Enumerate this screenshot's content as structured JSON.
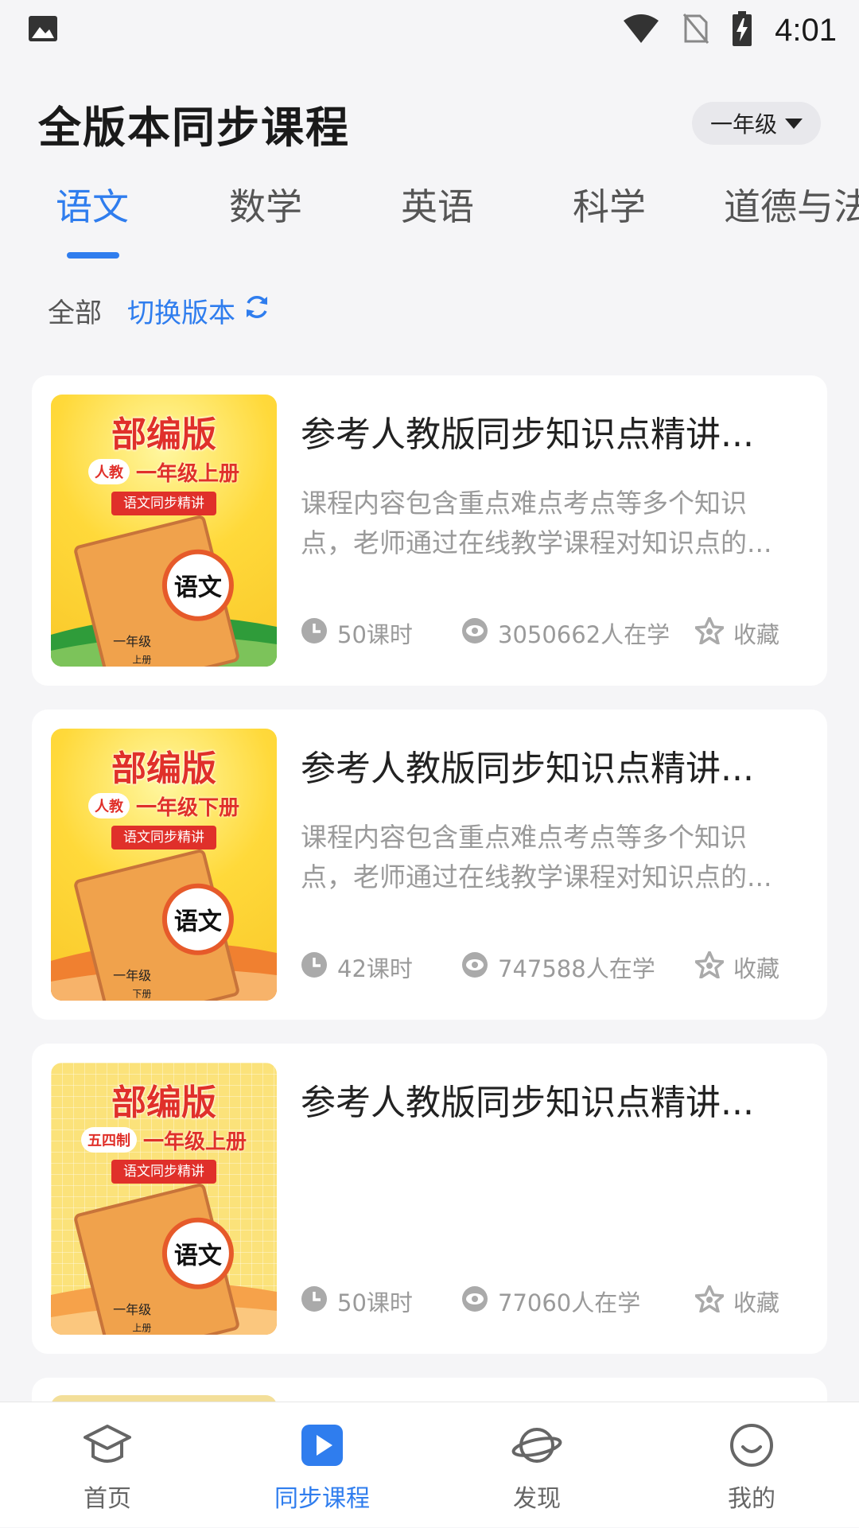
{
  "status_bar": {
    "time": "4:01"
  },
  "header": {
    "title": "全版本同步课程",
    "grade": "一年级"
  },
  "subject_tabs": [
    {
      "label": "语文",
      "active": true
    },
    {
      "label": "数学",
      "active": false
    },
    {
      "label": "英语",
      "active": false
    },
    {
      "label": "科学",
      "active": false
    },
    {
      "label": "道德与法",
      "active": false
    }
  ],
  "filter": {
    "all_label": "全部",
    "switch_label": "切换版本"
  },
  "courses": [
    {
      "title": "参考人教版同步知识点精讲...",
      "desc_line1": "课程内容包含重点难点考点等多个知识",
      "desc_line2": "点，老师通过在线教学课程对知识点的...",
      "lessons": "50课时",
      "learners": "3050662人在学",
      "favorite": "收藏",
      "cover": {
        "title": "部编版",
        "badge": "人教",
        "grade": "一年级上册",
        "subtitle": "语文同步精讲",
        "book_subject": "语文",
        "book_grade": "一年级",
        "book_volume": "上册",
        "accent": "#2f9c3a"
      }
    },
    {
      "title": "参考人教版同步知识点精讲...",
      "desc_line1": "课程内容包含重点难点考点等多个知识",
      "desc_line2": "点，老师通过在线教学课程对知识点的...",
      "lessons": "42课时",
      "learners": "747588人在学",
      "favorite": "收藏",
      "cover": {
        "title": "部编版",
        "badge": "人教",
        "grade": "一年级下册",
        "subtitle": "语文同步精讲",
        "book_subject": "语文",
        "book_grade": "一年级",
        "book_volume": "下册",
        "accent": "#f08030"
      }
    },
    {
      "title": "参考人教版同步知识点精讲...",
      "desc_line1": "",
      "desc_line2": "",
      "lessons": "50课时",
      "learners": "77060人在学",
      "favorite": "收藏",
      "cover": {
        "title": "部编版",
        "badge": "五四制",
        "grade": "一年级上册",
        "subtitle": "语文同步精讲",
        "book_subject": "语文",
        "book_grade": "一年级",
        "book_volume": "上册",
        "accent": "#f6a24a"
      }
    }
  ],
  "bottom_nav": [
    {
      "label": "首页",
      "icon": "graduation-cap-icon",
      "active": false
    },
    {
      "label": "同步课程",
      "icon": "play-icon",
      "active": true
    },
    {
      "label": "发现",
      "icon": "planet-icon",
      "active": false
    },
    {
      "label": "我的",
      "icon": "smile-icon",
      "active": false
    }
  ],
  "colors": {
    "accent": "#2f7dee",
    "muted": "#9a9a9a",
    "background": "#f5f5f7"
  }
}
